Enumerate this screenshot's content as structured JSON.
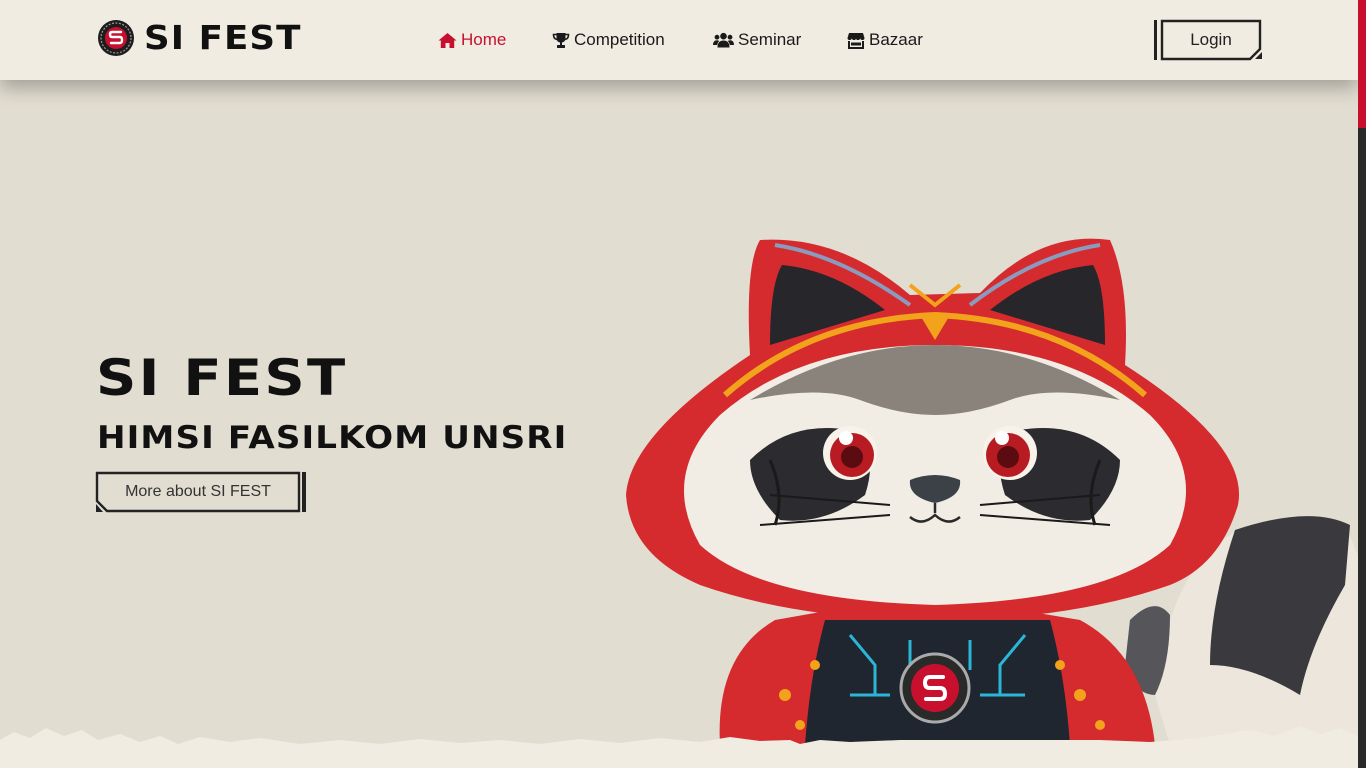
{
  "brand": {
    "name": "SI FEST"
  },
  "nav": {
    "items": [
      {
        "label": "Home",
        "icon": "home-icon",
        "active": true
      },
      {
        "label": "Competition",
        "icon": "trophy-icon",
        "active": false
      },
      {
        "label": "Seminar",
        "icon": "users-icon",
        "active": false
      },
      {
        "label": "Bazaar",
        "icon": "store-icon",
        "active": false
      }
    ],
    "login_label": "Login"
  },
  "hero": {
    "title": "SI FEST",
    "subtitle": "HIMSI FASILKOM UNSRI",
    "cta_label": "More about SI FEST"
  },
  "colors": {
    "accent": "#c8102e",
    "background": "#e2ddd1",
    "navbar": "#f0ece2",
    "text": "#111111"
  }
}
